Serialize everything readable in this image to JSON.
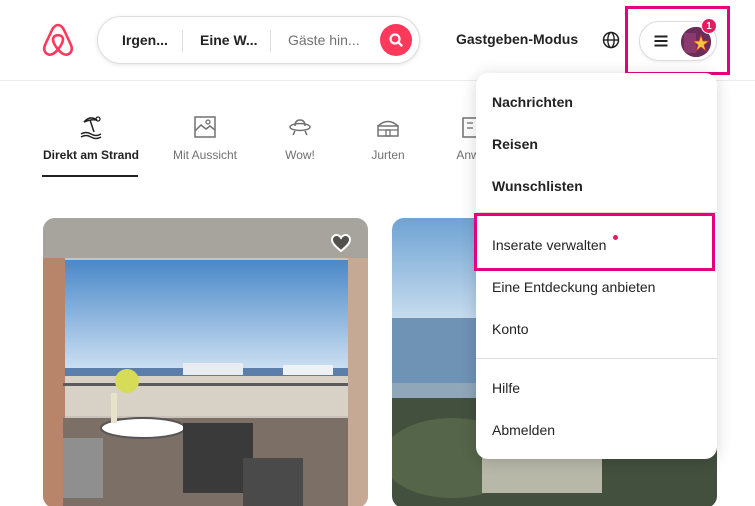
{
  "header": {
    "search": {
      "where": "Irgen...",
      "when": "Eine W...",
      "guests_placeholder": "Gäste hin..."
    },
    "host_mode_label": "Gastgeben-Modus",
    "notification_count": "1"
  },
  "categories": [
    {
      "label": "Direkt am Strand",
      "icon": "beach-icon",
      "active": true
    },
    {
      "label": "Mit Aussicht",
      "icon": "view-icon",
      "active": false
    },
    {
      "label": "Wow!",
      "icon": "ufo-icon",
      "active": false
    },
    {
      "label": "Jurten",
      "icon": "yurt-icon",
      "active": false
    },
    {
      "label": "Anw",
      "icon": "building-icon",
      "active": false
    }
  ],
  "menu": {
    "items_top": [
      "Nachrichten",
      "Reisen",
      "Wunschlisten"
    ],
    "items_middle": [
      "Inserate verwalten",
      "Eine Entdeckung anbieten",
      "Konto"
    ],
    "items_bottom": [
      "Hilfe",
      "Abmelden"
    ]
  },
  "colors": {
    "brand": "#ff385c",
    "highlight": "#e6007e"
  }
}
